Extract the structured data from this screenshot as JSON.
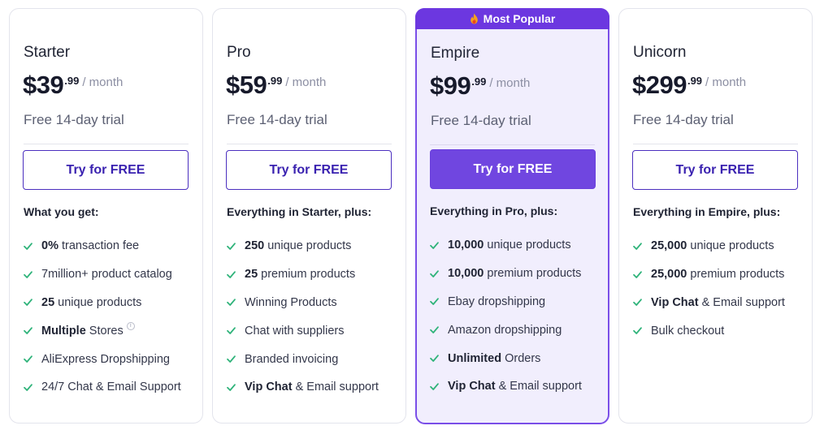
{
  "colors": {
    "accent": "#6c37e0",
    "check": "#2fb37a",
    "button_text": "#3a22b0"
  },
  "plans": [
    {
      "name": "Starter",
      "price": "$39",
      "cents": ".99",
      "period": "/ month",
      "trial": "Free 14-day trial",
      "cta": "Try for FREE",
      "features_heading": "What you get:",
      "features": [
        {
          "bold": "0%",
          "text": " transaction fee"
        },
        {
          "bold": "",
          "text": "7million+ product catalog"
        },
        {
          "bold": "25",
          "text": " unique products"
        },
        {
          "bold": "Multiple",
          "text": " Stores",
          "info_icon": "info-icon"
        },
        {
          "bold": "",
          "text": "AliExpress Dropshipping"
        },
        {
          "bold": "",
          "text": "24/7 Chat & Email Support"
        }
      ]
    },
    {
      "name": "Pro",
      "price": "$59",
      "cents": ".99",
      "period": "/ month",
      "trial": "Free 14-day trial",
      "cta": "Try for FREE",
      "features_heading": "Everything in Starter, plus:",
      "features": [
        {
          "bold": "250",
          "text": " unique products"
        },
        {
          "bold": "25",
          "text": " premium products"
        },
        {
          "bold": "",
          "text": "Winning Products"
        },
        {
          "bold": "",
          "text": "Chat with suppliers"
        },
        {
          "bold": "",
          "text": "Branded invoicing"
        },
        {
          "bold": "Vip Chat",
          "text": " & Email support"
        }
      ]
    },
    {
      "name": "Empire",
      "badge": "Most Popular",
      "price": "$99",
      "cents": ".99",
      "period": "/ month",
      "trial": "Free 14-day trial",
      "cta": "Try for FREE",
      "features_heading": "Everything in Pro, plus:",
      "features": [
        {
          "bold": "10,000",
          "text": " unique products"
        },
        {
          "bold": "10,000",
          "text": " premium products"
        },
        {
          "bold": "",
          "text": "Ebay dropshipping"
        },
        {
          "bold": "",
          "text": "Amazon dropshipping"
        },
        {
          "bold": "Unlimited",
          "text": " Orders"
        },
        {
          "bold": "Vip Chat",
          "text": " & Email support"
        }
      ]
    },
    {
      "name": "Unicorn",
      "price": "$299",
      "cents": ".99",
      "period": "/ month",
      "trial": "Free 14-day trial",
      "cta": "Try for FREE",
      "features_heading": "Everything in Empire, plus:",
      "features": [
        {
          "bold": "25,000",
          "text": " unique products"
        },
        {
          "bold": "25,000",
          "text": " premium products"
        },
        {
          "bold": "Vip Chat",
          "text": " & Email support"
        },
        {
          "bold": "",
          "text": "Bulk checkout"
        }
      ]
    }
  ]
}
